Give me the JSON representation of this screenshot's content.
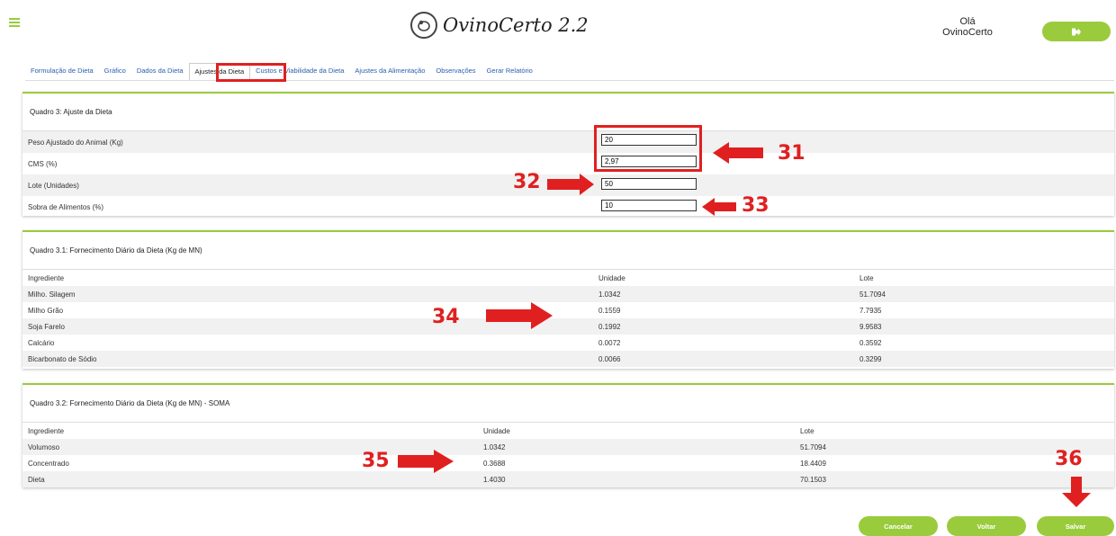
{
  "header": {
    "app_title": "OvinoCerto 2.2",
    "greeting_line1": "Olá",
    "greeting_line2": "OvinoCerto"
  },
  "tabs": [
    {
      "label": "Formulação de Dieta"
    },
    {
      "label": "Gráfico"
    },
    {
      "label": "Dados da Dieta"
    },
    {
      "label": "Ajustes da Dieta",
      "active": true
    },
    {
      "label": "Custos e Viabilidade da Dieta"
    },
    {
      "label": "Ajustes da Alimentação"
    },
    {
      "label": "Observações"
    },
    {
      "label": "Gerar Relatório"
    }
  ],
  "quadro3": {
    "title": "Quadro 3: Ajuste da Dieta",
    "rows": [
      {
        "label": "Peso Ajustado do Animal (Kg)",
        "value": "20"
      },
      {
        "label": "CMS (%)",
        "value": "2,97"
      },
      {
        "label": "Lote (Unidades)",
        "value": "50"
      },
      {
        "label": "Sobra de Alimentos (%)",
        "value": "10"
      }
    ]
  },
  "quadro31": {
    "title": "Quadro 3.1: Fornecimento Diário da Dieta (Kg de MN)",
    "headers": [
      "Ingrediente",
      "Unidade",
      "Lote"
    ],
    "rows": [
      [
        "Milho. Silagem",
        "1.0342",
        "51.7094"
      ],
      [
        "Milho Grão",
        "0.1559",
        "7.7935"
      ],
      [
        "Soja Farelo",
        "0.1992",
        "9.9583"
      ],
      [
        "Calcário",
        "0.0072",
        "0.3592"
      ],
      [
        "Bicarbonato de Sódio",
        "0.0066",
        "0.3299"
      ]
    ]
  },
  "quadro32": {
    "title": "Quadro 3.2: Fornecimento Diário da Dieta (Kg de MN) - SOMA",
    "headers": [
      "Ingrediente",
      "Unidade",
      "Lote"
    ],
    "rows": [
      [
        "Volumoso",
        "1.0342",
        "51.7094"
      ],
      [
        "Concentrado",
        "0.3688",
        "18.4409"
      ],
      [
        "Dieta",
        "1.4030",
        "70.1503"
      ]
    ]
  },
  "buttons": {
    "cancel": "Cancelar",
    "back": "Voltar",
    "save": "Salvar"
  },
  "annotations": {
    "n31": "31",
    "n32": "32",
    "n33": "33",
    "n34": "34",
    "n35": "35",
    "n36": "36"
  },
  "colors": {
    "accent": "#9acb3c",
    "annotation": "#e02020",
    "link": "#2a5db0"
  }
}
